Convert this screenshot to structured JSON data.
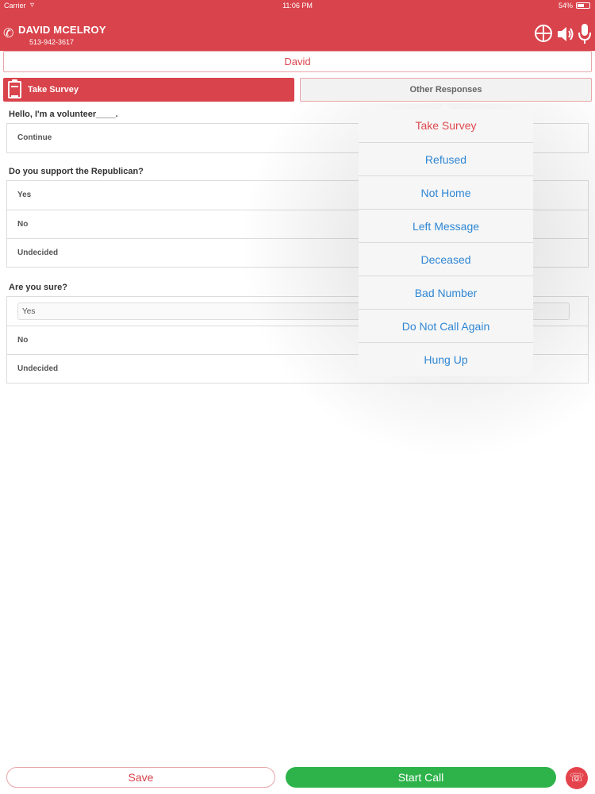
{
  "status": {
    "carrier": "Carrier",
    "time": "11:06 PM",
    "battery": "54%",
    "battery_level": 0.54
  },
  "header": {
    "name": "DAVID MCELROY",
    "number": "513-942-3617"
  },
  "contact": {
    "first_name": "David"
  },
  "tabs": {
    "take_survey": "Take Survey",
    "other_responses": "Other Responses"
  },
  "questions": [
    {
      "title": "Hello, I'm a volunteer____.",
      "answers": [
        "Continue"
      ]
    },
    {
      "title": "Do you support the Republican?",
      "answers": [
        "Yes",
        "No",
        "Undecided"
      ]
    },
    {
      "title": "Are you sure?",
      "answers": [
        "Yes",
        "No",
        "Undecided"
      ],
      "selected": "Yes"
    }
  ],
  "popover": {
    "items": [
      "Take Survey",
      "Refused",
      "Not Home",
      "Left Message",
      "Deceased",
      "Bad Number",
      "Do Not Call Again",
      "Hung Up"
    ],
    "active": "Take Survey"
  },
  "footer": {
    "save": "Save",
    "start_call": "Start Call"
  },
  "colors": {
    "brand_red": "#d9434b",
    "call_green": "#2db34a",
    "link_blue": "#2f86d4"
  },
  "icons": [
    "wifi-icon",
    "battery-icon",
    "phone-icon",
    "globe-icon",
    "speaker-icon",
    "microphone-icon",
    "clipboard-icon",
    "hangup-icon"
  ]
}
